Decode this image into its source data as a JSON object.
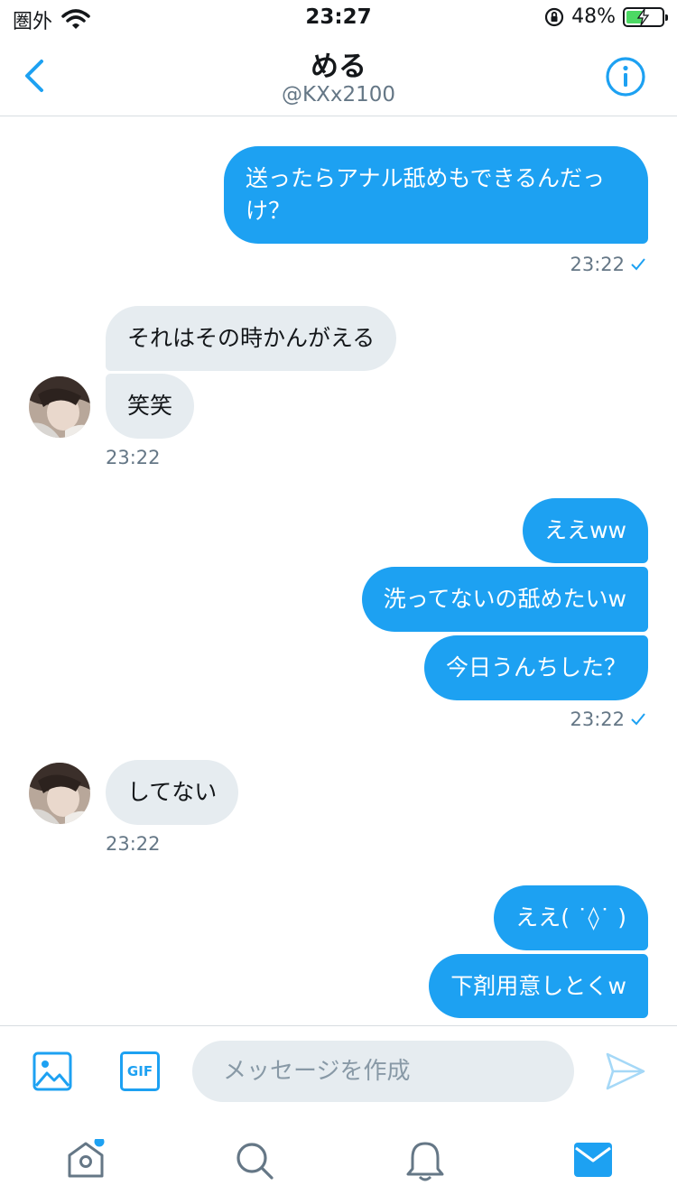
{
  "status": {
    "carrier": "圏外",
    "time": "23:27",
    "battery": "48%",
    "battery_level": 0.48
  },
  "header": {
    "name": "める",
    "handle": "@KXx2100"
  },
  "messages": {
    "m1": "送ったらアナル舐めもできるんだっけ？",
    "t1": "23:22",
    "r1": "それはその時かんがえる",
    "r2": "笑笑",
    "t2": "23:22",
    "m2": "ええww",
    "m3": "洗ってないの舐めたいw",
    "m4": "今日うんちした？",
    "t3": "23:22",
    "r3": "してない",
    "t4": "23:22",
    "m5": "ええ( ˙◊˙ )",
    "m6": "下剤用意しとくw"
  },
  "composer": {
    "placeholder": "メッセージを作成",
    "gif_label": "GIF"
  },
  "colors": {
    "accent": "#1da1f2",
    "received_bubble": "#e6ecf0",
    "secondary_text": "#657786"
  }
}
